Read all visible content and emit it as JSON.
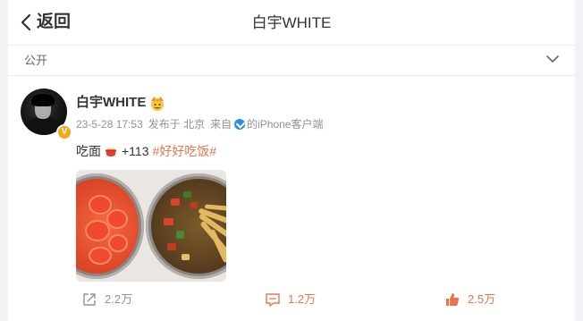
{
  "header": {
    "back_label": "返回",
    "title": "白宇WHITE"
  },
  "visibility": {
    "label": "公开"
  },
  "post": {
    "username": "白宇WHITE",
    "time": "23-5-28 17:53",
    "location": "发布于 北京",
    "source_prefix": "来自",
    "source": "的iPhone客户端",
    "text_before": "吃面",
    "text_after": "+113",
    "hashtag": "#好好吃饭#",
    "verified_badge": "V"
  },
  "actions": {
    "share_count": "2.2万",
    "comment_count": "1.2万",
    "like_count": "2.5万"
  },
  "colors": {
    "accent": "#eb7350",
    "muted": "#939393",
    "verified": "#f6a41a"
  },
  "icons": [
    "chevron-left-icon",
    "chevron-down-icon",
    "crown-emoji-icon",
    "iphone-source-icon",
    "noodle-emoji-icon",
    "share-icon",
    "comment-icon",
    "like-icon"
  ]
}
